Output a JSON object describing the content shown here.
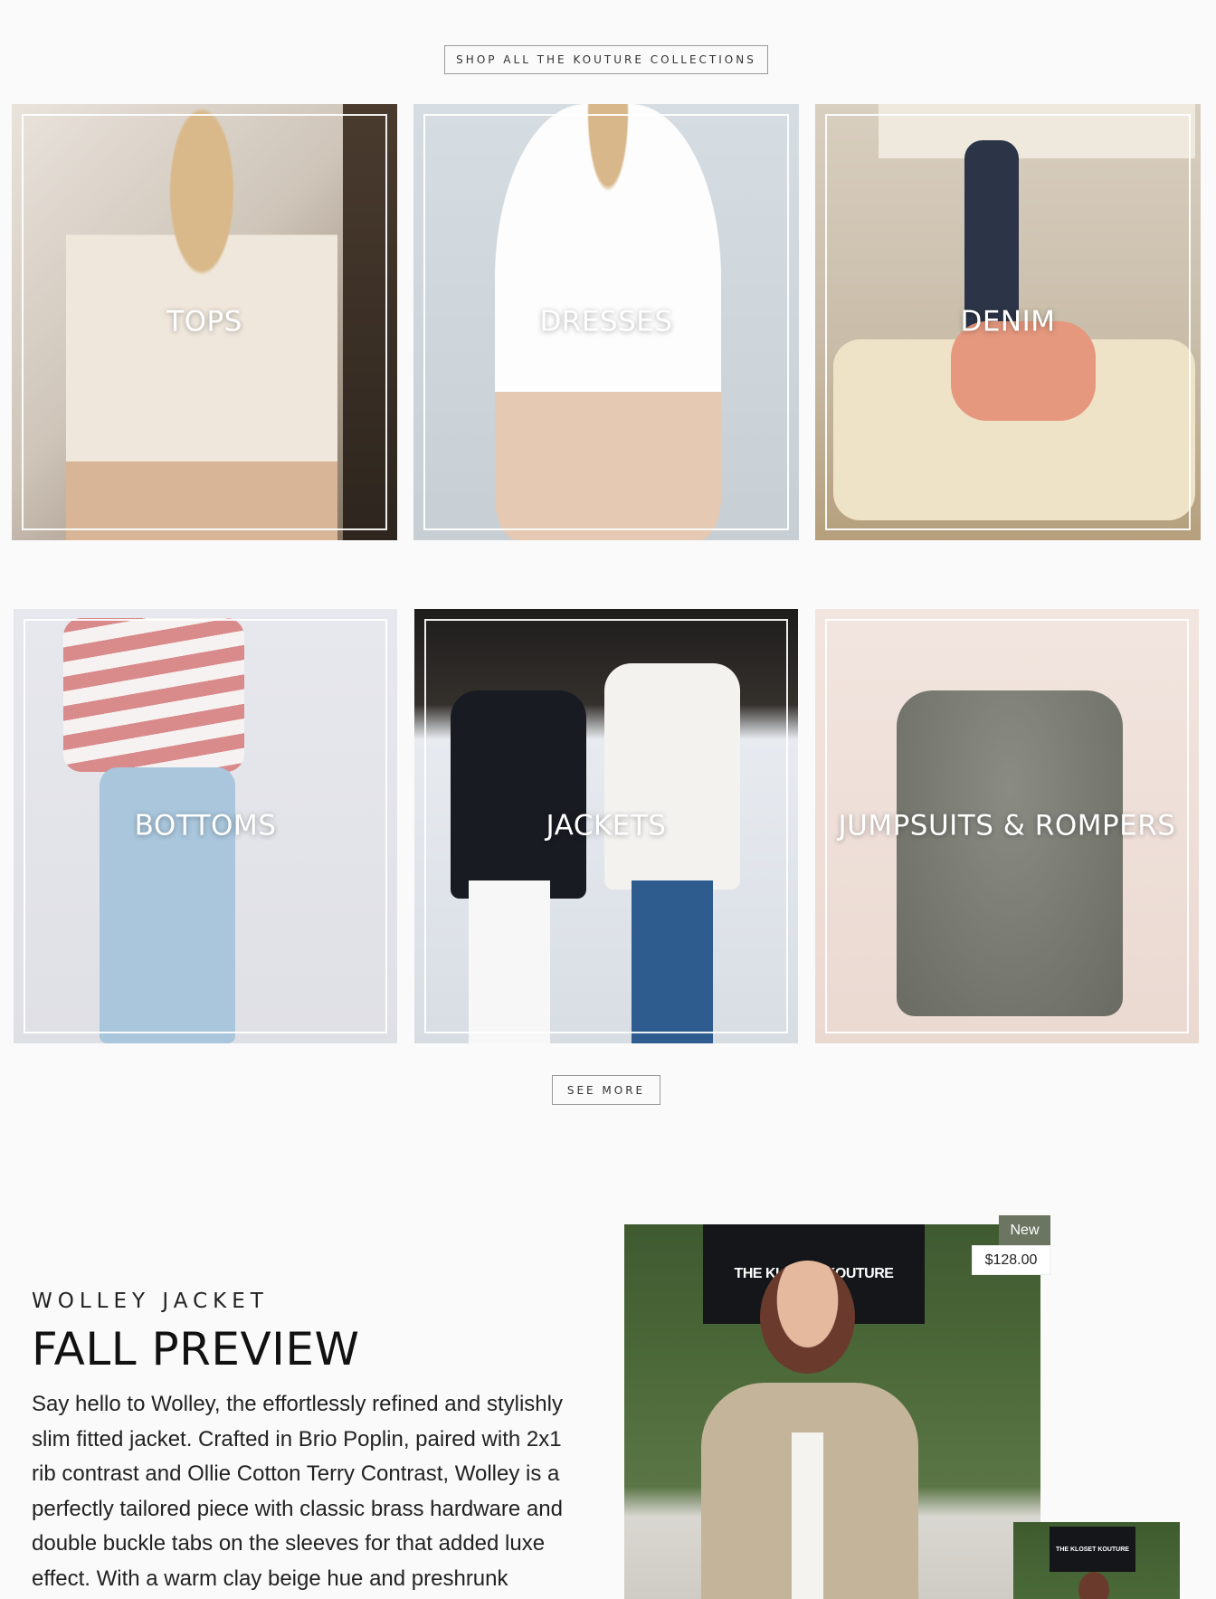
{
  "collections": {
    "shop_all_label": "SHOP ALL THE KOUTURE COLLECTIONS",
    "see_more_label": "SEE MORE",
    "tiles": [
      {
        "label": "TOPS"
      },
      {
        "label": "DRESSES"
      },
      {
        "label": "DENIM"
      },
      {
        "label": "BOTTOMS"
      },
      {
        "label": "JACKETS"
      },
      {
        "label": "JUMPSUITS & ROMPERS"
      }
    ]
  },
  "featured": {
    "eyebrow": "WOLLEY JACKET",
    "title": "FALL PREVIEW",
    "description": "Say hello to Wolley, the effortlessly refined and stylishly slim fitted jacket. Crafted in Brio Poplin, paired with 2x1 rib contrast and Ollie Cotton Terry Contrast, Wolley is a perfectly tailored piece with classic brass hardware and double buckle tabs on the sleeves for that added luxe effect. With a warm clay beige hue and preshrunk",
    "badge": "New",
    "price": "$128.00",
    "sign_text": "THE KLOSET KOUTURE",
    "thumb_sign_text": "THE KLOSET KOUTURE"
  },
  "colors": {
    "badge_bg": "#6b7562",
    "frame": "#ffffff",
    "page_bg": "#fafafa"
  }
}
